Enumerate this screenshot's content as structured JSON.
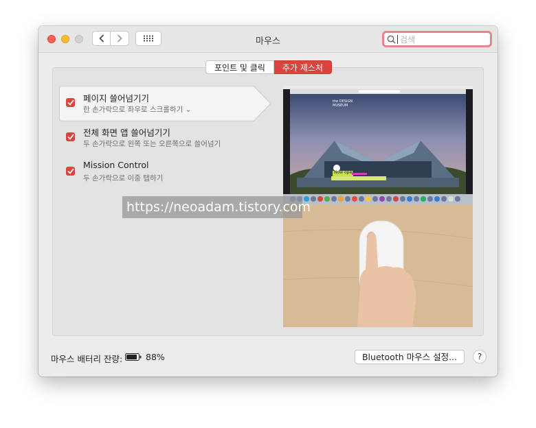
{
  "window": {
    "title": "마우스"
  },
  "search": {
    "placeholder": "검색"
  },
  "tabs": [
    {
      "label": "포인트 및 클릭",
      "active": false
    },
    {
      "label": "추가 제스처",
      "active": true
    }
  ],
  "gestures": [
    {
      "title": "페이지 쓸어넘기기",
      "subtitle": "한 손가락으로 좌우로 스크롤하기 ⌄",
      "checked": true
    },
    {
      "title": "전체 화면 앱 쓸어넘기기",
      "subtitle": "두 손가락으로 왼쪽 또는 오른쪽으로 쓸어넘기",
      "checked": true
    },
    {
      "title": "Mission Control",
      "subtitle": "두 손가락으로 이중 탭하기",
      "checked": true
    }
  ],
  "preview": {
    "site_brand": "the DESIGN MUSEUM",
    "banner": "Now open"
  },
  "watermark": "https://neoadam.tistory.com",
  "footer": {
    "battery_label": "마우스 배터리 잔량:",
    "battery_percent": "88%",
    "battery_level": 0.88,
    "bluetooth_button": "Bluetooth 마우스 설정...",
    "help": "?"
  },
  "colors": {
    "accent": "#d9453e",
    "search_focus": "#e2858e"
  }
}
